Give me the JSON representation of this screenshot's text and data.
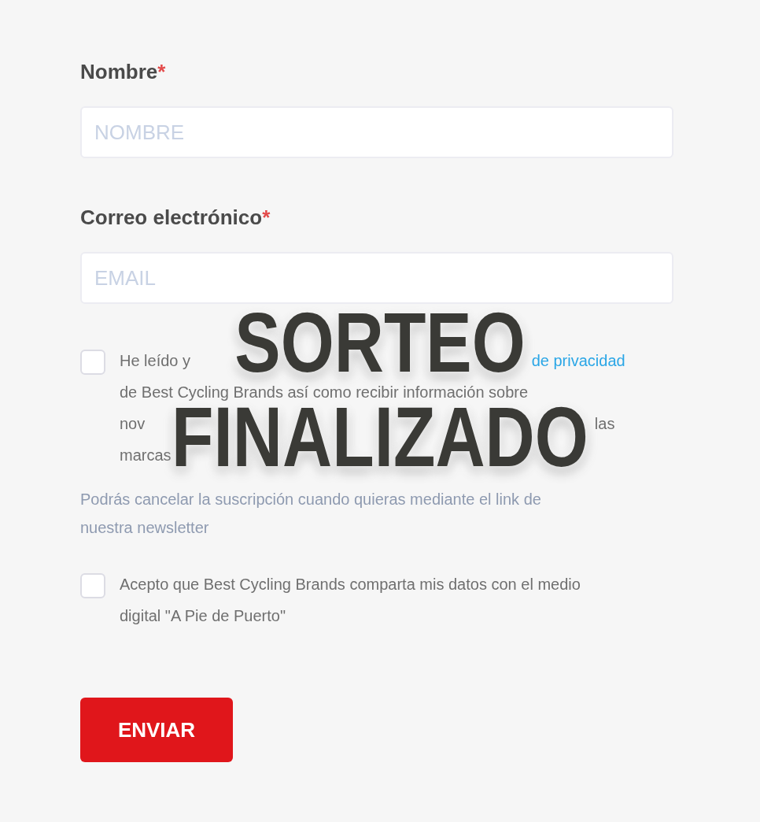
{
  "form": {
    "fields": [
      {
        "label": "Nombre",
        "required_mark": "*",
        "placeholder": "NOMBRE"
      },
      {
        "label": "Correo electrónico",
        "required_mark": "*",
        "placeholder": "EMAIL"
      }
    ],
    "items": [
      {
        "kind": "checkbox",
        "checked": false,
        "lines": [
          [
            {
              "kind": "text",
              "text": "He leído y"
            },
            {
              "kind": "link",
              "text": "de privacidad"
            }
          ],
          [
            {
              "kind": "text",
              "text": "de Best Cycling Brands así como recibir información sobre"
            }
          ],
          [
            {
              "kind": "text",
              "text": "nov"
            },
            {
              "kind": "text",
              "text": "las"
            }
          ],
          [
            {
              "kind": "text",
              "text": "marcas"
            }
          ]
        ]
      },
      {
        "kind": "note",
        "lines": [
          "Podrás cancelar la suscripción cuando quieras mediante el link de",
          "nuestra newsletter"
        ]
      },
      {
        "kind": "checkbox",
        "checked": false,
        "lines": [
          [
            {
              "kind": "text",
              "text": "Acepto que Best Cycling Brands comparta mis datos con el medio"
            }
          ],
          [
            {
              "kind": "text",
              "text": "digital \"A Pie de Puerto\""
            }
          ]
        ]
      }
    ],
    "submit": {
      "label": "ENVIAR"
    }
  },
  "banner": {
    "lines": [
      "SORTEO",
      "FINALIZADO"
    ]
  }
}
